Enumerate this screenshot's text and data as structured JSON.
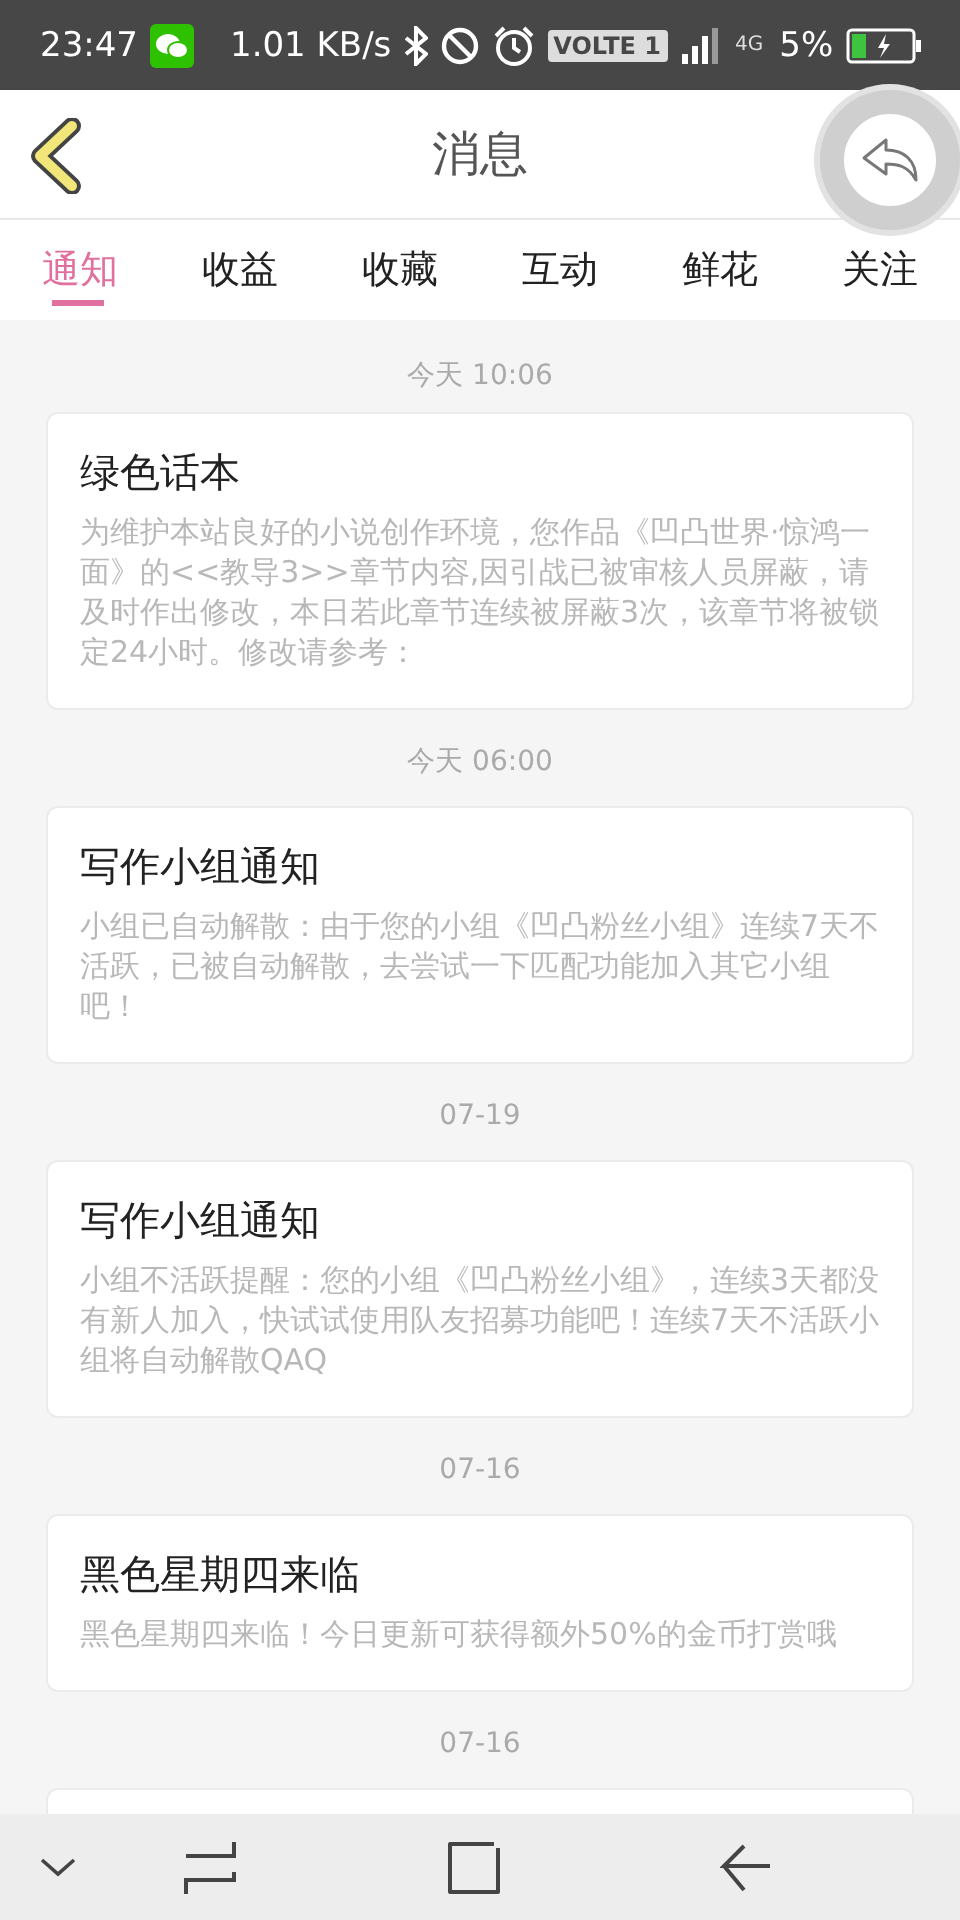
{
  "status_bar": {
    "time": "23:47",
    "network_speed": "1.01 KB/s",
    "volte_badge": "VOLTE 1",
    "network_type": "4G",
    "battery_percent": "5%"
  },
  "header": {
    "title": "消息"
  },
  "tabs": [
    {
      "label": "通知",
      "selected": true
    },
    {
      "label": "收益",
      "selected": false
    },
    {
      "label": "收藏",
      "selected": false
    },
    {
      "label": "互动",
      "selected": false
    },
    {
      "label": "鲜花",
      "selected": false
    },
    {
      "label": "关注",
      "selected": false
    }
  ],
  "messages": [
    {
      "time": "今天 10:06",
      "title": "绿色话本",
      "body": "为维护本站良好的小说创作环境，您作品《凹凸世界·惊鸿一面》的<<教导3>>章节内容,因引战已被审核人员屏蔽，请及时作出修改，本日若此章节连续被屏蔽3次，该章节将被锁定24小时。修改请参考："
    },
    {
      "time": "今天 06:00",
      "title": "写作小组通知",
      "body": "小组已自动解散：由于您的小组《凹凸粉丝小组》连续7天不活跃，已被自动解散，去尝试一下匹配功能加入其它小组吧！"
    },
    {
      "time": "07-19",
      "title": "写作小组通知",
      "body": "小组不活跃提醒：您的小组《凹凸粉丝小组》，连续3天都没有新人加入，快试试使用队友招募功能吧！连续7天不活跃小组将自动解散QAQ"
    },
    {
      "time": "07-16",
      "title": "黑色星期四来临",
      "body": "黑色星期四来临！今日更新可获得额外50%的金币打赏哦"
    },
    {
      "time": "07-16"
    }
  ]
}
